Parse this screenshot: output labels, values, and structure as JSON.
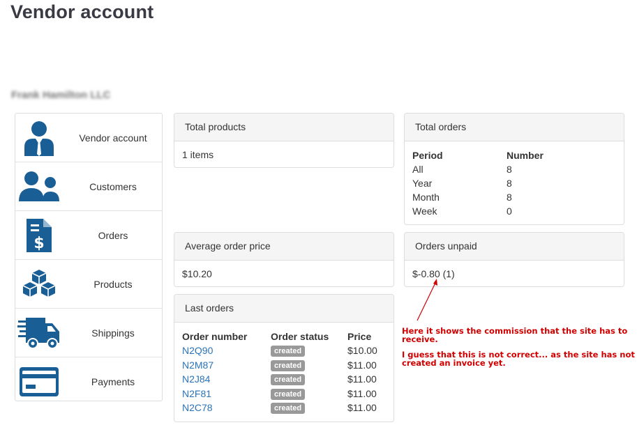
{
  "page": {
    "title": "Vendor account",
    "vendor_name": "Frank Hamilton LLC"
  },
  "sidebar": {
    "items": [
      {
        "label": "Vendor account",
        "icon": "vendor-user-icon"
      },
      {
        "label": "Customers",
        "icon": "customers-icon"
      },
      {
        "label": "Orders",
        "icon": "invoice-dollar-icon"
      },
      {
        "label": "Products",
        "icon": "boxes-icon"
      },
      {
        "label": "Shippings",
        "icon": "truck-icon"
      },
      {
        "label": "Payments",
        "icon": "credit-card-icon"
      }
    ],
    "icon_color": "#1a5e96"
  },
  "total_products": {
    "heading": "Total products",
    "value": "1 items"
  },
  "average_order_price": {
    "heading": "Average order price",
    "value": "$10.20"
  },
  "total_orders": {
    "heading": "Total orders",
    "columns": [
      "Period",
      "Number"
    ],
    "rows": [
      {
        "period": "All",
        "number": "8"
      },
      {
        "period": "Year",
        "number": "8"
      },
      {
        "period": "Month",
        "number": "8"
      },
      {
        "period": "Week",
        "number": "0"
      }
    ]
  },
  "orders_unpaid": {
    "heading": "Orders unpaid",
    "value": "$-0.80 (1)"
  },
  "last_orders": {
    "heading": "Last orders",
    "columns": [
      "Order number",
      "Order status",
      "Price"
    ],
    "rows": [
      {
        "number": "N2Q90",
        "status": "created",
        "price": "$10.00"
      },
      {
        "number": "N2M87",
        "status": "created",
        "price": "$11.00"
      },
      {
        "number": "N2J84",
        "status": "created",
        "price": "$11.00"
      },
      {
        "number": "N2F81",
        "status": "created",
        "price": "$11.00"
      },
      {
        "number": "N2C78",
        "status": "created",
        "price": "$11.00"
      }
    ]
  },
  "annotation": {
    "line1": "Here it shows the commission that the site has to",
    "line2": "receive.",
    "line3": "I guess that this is not correct... as the site has not",
    "line4": "created an invoice yet.",
    "color": "#d00000"
  }
}
